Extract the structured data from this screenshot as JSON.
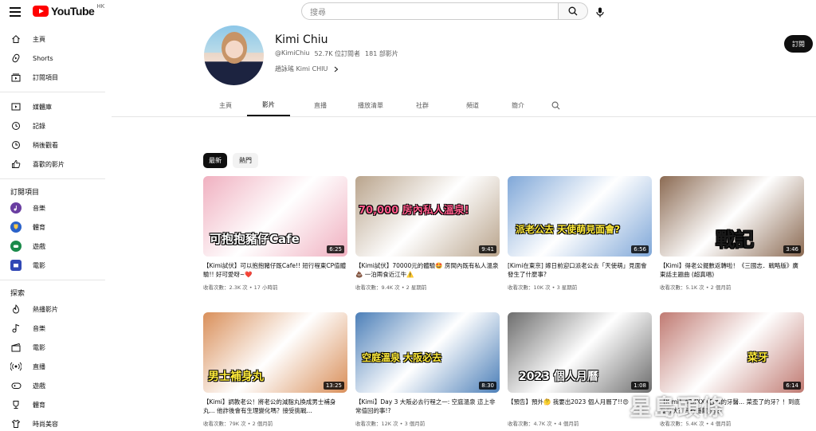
{
  "header": {
    "logo_text": "YouTube",
    "region": "HK",
    "search_placeholder": "搜尋",
    "icons": {
      "menu": "menu-icon",
      "search": "search-icon",
      "mic": "mic-icon"
    }
  },
  "sidebar": {
    "main": [
      {
        "label": "主頁",
        "icon": "home-icon"
      },
      {
        "label": "Shorts",
        "icon": "shorts-icon"
      },
      {
        "label": "訂閱項目",
        "icon": "subscriptions-icon"
      }
    ],
    "library": [
      {
        "label": "媒體庫",
        "icon": "library-icon"
      },
      {
        "label": "記錄",
        "icon": "history-icon"
      },
      {
        "label": "稍後觀看",
        "icon": "watch-later-icon"
      },
      {
        "label": "喜歡的影片",
        "icon": "like-icon"
      }
    ],
    "subscriptions_heading": "訂閱項目",
    "subscriptions": [
      {
        "label": "音樂",
        "color": "#6a3ea1"
      },
      {
        "label": "體育",
        "color": "#2b62c9"
      },
      {
        "label": "遊戲",
        "color": "#1a8a4a"
      },
      {
        "label": "電影",
        "color": "#3148b5"
      }
    ],
    "explore_heading": "探索",
    "explore": [
      {
        "label": "熱播影片",
        "icon": "trending-icon"
      },
      {
        "label": "音樂",
        "icon": "music-icon"
      },
      {
        "label": "電影",
        "icon": "film-icon"
      },
      {
        "label": "直播",
        "icon": "live-icon"
      },
      {
        "label": "遊戲",
        "icon": "gaming-icon"
      },
      {
        "label": "體育",
        "icon": "trophy-icon"
      },
      {
        "label": "時尚美容",
        "icon": "fashion-icon"
      }
    ]
  },
  "channel": {
    "name": "Kimi Chiu",
    "handle": "@KimiChiu",
    "subscribers": "52.7K 位訂閱者",
    "videos": "181 部影片",
    "description": "趙詠瑤 Kimi CHIU",
    "subscribe_label": "訂閱"
  },
  "tabs": [
    "主頁",
    "影片",
    "直播",
    "播放清單",
    "社群",
    "頻道",
    "簡介"
  ],
  "active_tab": "影片",
  "chips": {
    "latest": "最新",
    "popular": "熱門"
  },
  "videos": [
    {
      "title": "【Kimi試伏】可以抱抱豬仔既Cafe!! 短行程東CP值體驗!! 好可愛呀~❤️",
      "meta": "收看次數：2.3K 次 • 17 小時前",
      "duration": "6:25",
      "caption": "可抱抱豬仔Cafe",
      "bg": "#f0b0c0",
      "cap_color": "#ffffff"
    },
    {
      "title": "【Kimi試伏】70000元的體驗🤩 房間內既有私人溫泉💩 一泊兩食近江牛⚠️",
      "meta": "收看次數：9.4K 次 • 2 星期前",
      "duration": "9:41",
      "caption": "70,000 房內私人溫泉!",
      "bg": "#b9a48c",
      "cap_color": "#ff5a8a"
    },
    {
      "title": "[Kimi在東京] 嫁日前迎口派老公去「天使萌」見面會發生了什麼事?",
      "meta": "收看次數：10K 次 • 3 星期前",
      "duration": "6:56",
      "caption": "派老公去 天使萌見面會?",
      "bg": "#7fa7d8",
      "cap_color": "#ffeb3b"
    },
    {
      "title": "【Kimi】得老公擺數返轉啦！《三國志．戰略版》廣東話主題曲 (超真唱)",
      "meta": "收看次數：5.1K 次 • 2 個月前",
      "duration": "3:46",
      "caption": "戰記",
      "bg": "#8b6a52",
      "cap_color": "#1a1a1a"
    },
    {
      "title": "【Kimi】調教老公！將老公的減脂丸換成男士補身丸... 他詐後會有生理變化嗎？接受挑戰...",
      "meta": "收看次數：79K 次 • 2 個月前",
      "duration": "13:25",
      "caption": "男士補身丸",
      "bg": "#d98f5a",
      "cap_color": "#ffeb3b"
    },
    {
      "title": "【Kimi】Day 3 大阪必去行程之一: 空庭溫泉 這上非常值回的事!?",
      "meta": "收看次數：12K 次 • 3 個月前",
      "duration": "8:30",
      "caption": "空庭溫泉 大阪必去",
      "bg": "#4c7fb8",
      "cap_color": "#ffeb3b"
    },
    {
      "title": "【預告】預外🤔 我要出2023 個人月曆了!!😍",
      "meta": "收看次數：4.7K 次 • 4 個月前",
      "duration": "1:08",
      "caption": "2023 個人月曆",
      "bg": "#6d6d6d",
      "cap_color": "#ffffff"
    },
    {
      "title": "【Kimi】$2XXXX日本的牙醫... 菜歪了的牙？！到底有冇伏？有冇隱藏收費？",
      "meta": "收看次數：5.4K 次 • 4 個月前",
      "duration": "6:14",
      "caption": "菜牙",
      "bg": "#c07a72",
      "cap_color": "#ffeb3b"
    }
  ],
  "watermark": "星島頭條"
}
